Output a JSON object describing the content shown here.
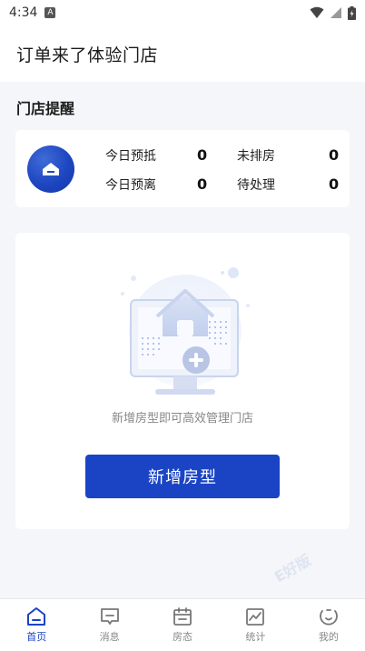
{
  "status_bar": {
    "time": "4:34",
    "notification_badge": "A",
    "icons": [
      "wifi-icon",
      "signal-icon",
      "battery-icon"
    ]
  },
  "header": {
    "title": "订单来了体验门店"
  },
  "store_reminder": {
    "title": "门店提醒",
    "stats": [
      {
        "label": "今日预抵",
        "value": "0"
      },
      {
        "label": "未排房",
        "value": "0"
      },
      {
        "label": "今日预离",
        "value": "0"
      },
      {
        "label": "待处理",
        "value": "0"
      }
    ]
  },
  "empty_state": {
    "text": "新增房型即可高效管理门店",
    "button_label": "新增房型"
  },
  "tab_bar": {
    "items": [
      {
        "label": "首页",
        "icon": "home-icon",
        "active": true
      },
      {
        "label": "消息",
        "icon": "message-icon",
        "active": false
      },
      {
        "label": "房态",
        "icon": "calendar-icon",
        "active": false
      },
      {
        "label": "统计",
        "icon": "chart-icon",
        "active": false
      },
      {
        "label": "我的",
        "icon": "profile-icon",
        "active": false
      }
    ]
  },
  "watermark": "E好版",
  "colors": {
    "accent": "#1a44c4",
    "background": "#f4f6f9"
  }
}
